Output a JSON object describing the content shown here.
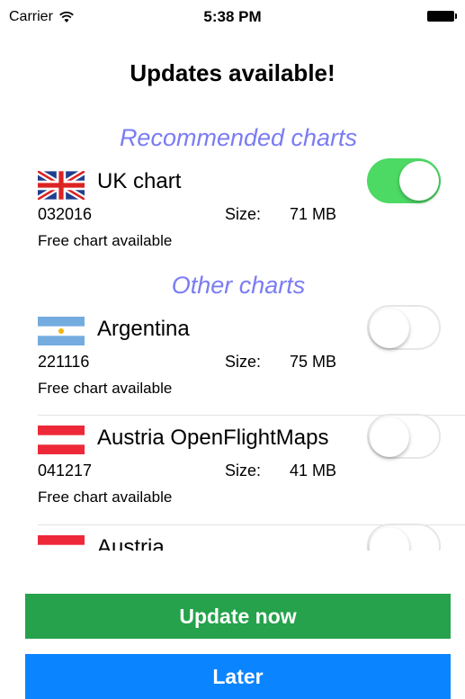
{
  "status_bar": {
    "carrier": "Carrier",
    "time": "5:38 PM"
  },
  "title": "Updates available!",
  "sections": {
    "recommended": "Recommended charts",
    "other": "Other charts"
  },
  "recommended_charts": [
    {
      "name": "UK chart",
      "code": "032016",
      "size_label": "Size:",
      "size": "71 MB",
      "note": "Free chart available",
      "selected": true
    }
  ],
  "other_charts": [
    {
      "name": "Argentina",
      "code": "221116",
      "size_label": "Size:",
      "size": "75 MB",
      "note": "Free chart available",
      "selected": false
    },
    {
      "name": "Austria OpenFlightMaps",
      "code": "041217",
      "size_label": "Size:",
      "size": "41 MB",
      "note": "Free chart available",
      "selected": false
    },
    {
      "name": "Austria",
      "selected": false
    }
  ],
  "buttons": {
    "update": "Update now",
    "later": "Later"
  },
  "colors": {
    "section_header": "#7a7cf3",
    "toggle_on": "#4cd964",
    "update_button": "#25a24b",
    "later_button": "#0a84ff"
  },
  "icons": {
    "uk": "flag-uk-icon",
    "argentina": "flag-argentina-icon",
    "austria": "flag-austria-icon",
    "wifi": "wifi-icon",
    "battery": "battery-icon"
  }
}
